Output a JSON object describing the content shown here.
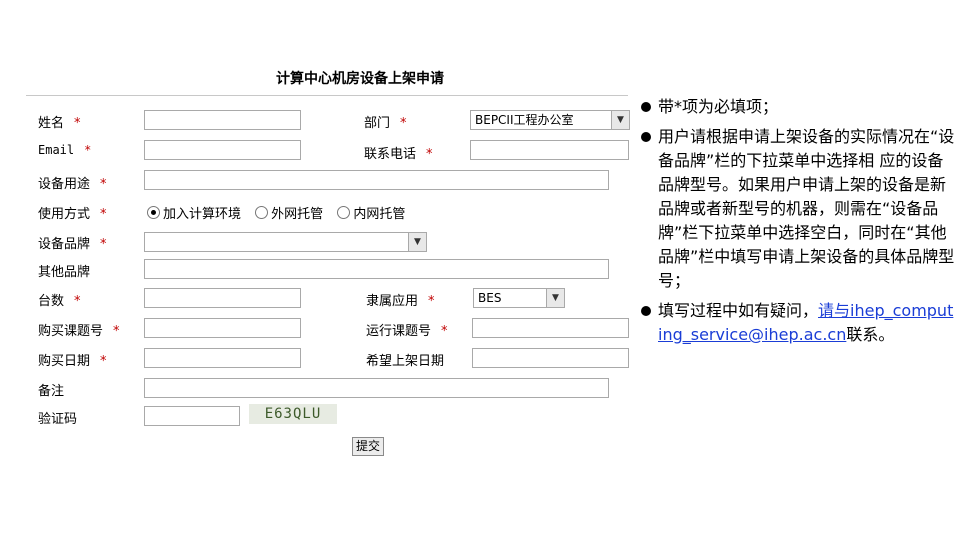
{
  "form": {
    "title": "计算中心机房设备上架申请",
    "required_mark": "*",
    "labels": {
      "name": "姓名",
      "email": "Email",
      "purpose": "设备用途",
      "usage": "使用方式",
      "brand": "设备品牌",
      "other_brand": "其他品牌",
      "quantity": "台数",
      "purchase_project": "购买课题号",
      "purchase_date": "购买日期",
      "remark": "备注",
      "captcha": "验证码",
      "department": "部门",
      "phone": "联系电话",
      "application": "隶属应用",
      "run_project": "运行课题号",
      "rack_date": "希望上架日期"
    },
    "department_value": "BEPCII工程办公室",
    "application_value": "BES",
    "usage_options": [
      {
        "label": "加入计算环境",
        "checked": true
      },
      {
        "label": "外网托管",
        "checked": false
      },
      {
        "label": "内网托管",
        "checked": false
      }
    ],
    "captcha_text": "E63QLU",
    "submit_label": "提交"
  },
  "notes": [
    {
      "text": "带*项为必填项；"
    },
    {
      "text": "用户请根据申请上架设备的实际情况在“设备品牌”栏的下拉菜单中选择相 应的设备品牌型号。如果用户申请上架的设备是新品牌或者新型号的机器，则需在“设备品牌”栏下拉菜单中选择空白，同时在“其他品牌”栏中填写申请上架设备的具体品牌型号；"
    },
    {
      "text_before": "填写过程中如有疑问，",
      "link_text": "请与ihep_computing_service@ihep.ac.cn",
      "text_after": "联系。"
    }
  ]
}
